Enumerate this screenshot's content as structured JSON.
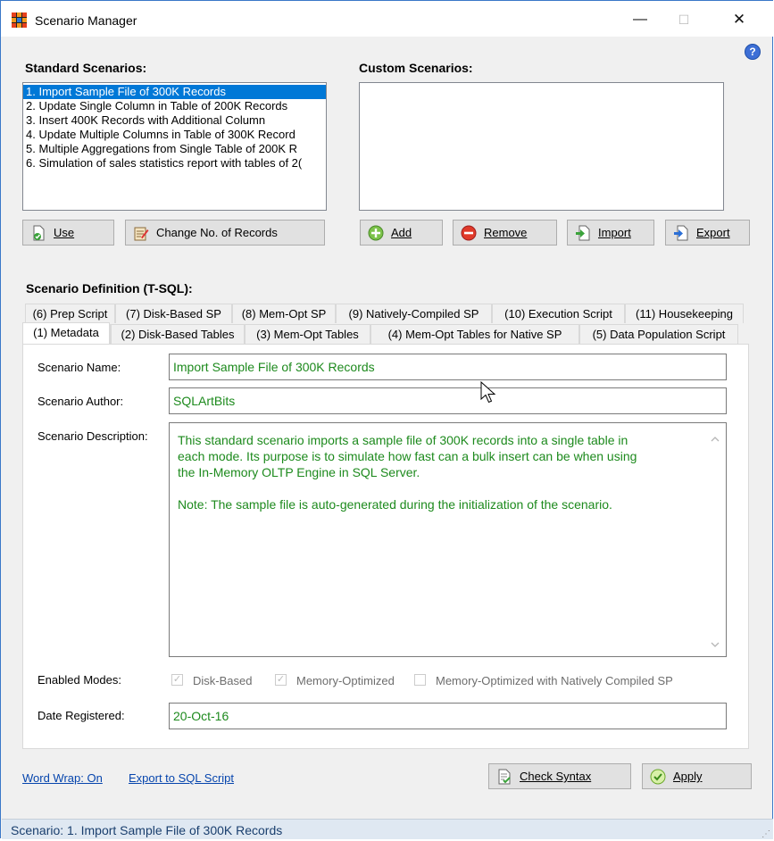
{
  "window": {
    "title": "Scenario Manager",
    "minimize_glyph": "—",
    "maximize_glyph": "☐",
    "close_glyph": "✕",
    "help_glyph": "?"
  },
  "standard": {
    "header": "Standard Scenarios:",
    "items": [
      "1. Import Sample File of 300K Records",
      "2. Update Single Column in Table of 200K Records",
      "3. Insert 400K Records with Additional Column",
      "4. Update Multiple Columns in Table of 300K Record",
      "5. Multiple Aggregations from Single Table of 200K R",
      "6. Simulation of sales statistics report with tables of 2("
    ],
    "selected_index": 0,
    "use_button": "Use",
    "change_records_button": "Change No. of Records"
  },
  "custom": {
    "header": "Custom Scenarios:",
    "add_button": "Add",
    "remove_button": "Remove",
    "import_button": "Import",
    "export_button": "Export"
  },
  "definition": {
    "header": "Scenario Definition (T-SQL):",
    "tabs_row1": [
      "(6) Prep Script",
      "(7) Disk-Based SP",
      "(8) Mem-Opt SP",
      "(9) Natively-Compiled SP",
      "(10) Execution Script",
      "(11) Housekeeping"
    ],
    "tabs_row2": [
      "(1) Metadata",
      "(2) Disk-Based Tables",
      "(3) Mem-Opt Tables",
      "(4) Mem-Opt Tables for Native SP",
      "(5) Data Population Script"
    ],
    "active_tab": "(1) Metadata"
  },
  "metadata": {
    "name_label": "Scenario Name:",
    "name_value": "Import Sample File of 300K Records",
    "author_label": "Scenario Author:",
    "author_value": "SQLArtBits",
    "description_label": "Scenario Description:",
    "description_lines": [
      "This standard scenario imports a sample file of 300K records into a single table in",
      "each mode. Its purpose is to simulate how fast can a bulk insert can be when using",
      "the In-Memory OLTP Engine in SQL Server.",
      "",
      "Note: The sample file is auto-generated during the initialization of the scenario."
    ],
    "modes_label": "Enabled Modes:",
    "modes": [
      {
        "label": "Disk-Based",
        "checked": true
      },
      {
        "label": "Memory-Optimized",
        "checked": true
      },
      {
        "label": "Memory-Optimized with Natively Compiled SP",
        "checked": false
      }
    ],
    "date_label": "Date Registered:",
    "date_value": "20-Oct-16"
  },
  "footer": {
    "word_wrap_link": "Word Wrap: On",
    "export_link": "Export to SQL Script",
    "check_syntax_button": "Check Syntax",
    "apply_button": "Apply"
  },
  "status": {
    "text": "Scenario: 1. Import Sample File of 300K Records"
  },
  "colors": {
    "selection": "#0078d7",
    "value_text": "#1d8a1d",
    "link": "#0645ad",
    "status_bar": "#dfe8f2"
  }
}
